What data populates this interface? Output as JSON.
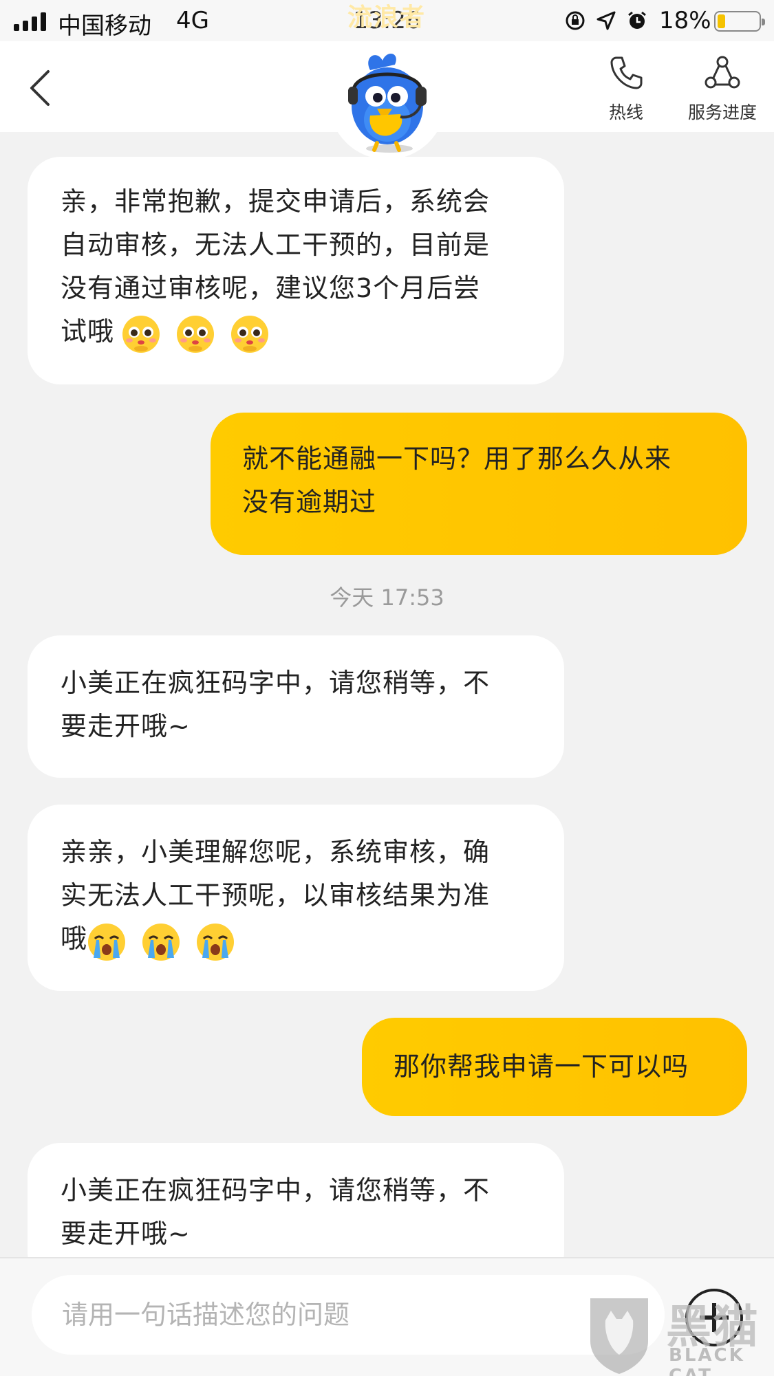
{
  "status_bar": {
    "carrier": "中国移动",
    "network": "4G",
    "time": "13:26",
    "watermark": "流浪者",
    "battery_percent": "18%",
    "battery_level": 0.18,
    "icons": [
      "rotation-lock-icon",
      "location-icon",
      "alarm-icon"
    ]
  },
  "header": {
    "back_icon": "chevron-left-icon",
    "mascot": "bird-mascot-avatar",
    "hotline_label": "热线",
    "hotline_icon": "phone-icon",
    "progress_label": "服务进度",
    "progress_icon": "process-nodes-icon"
  },
  "messages": [
    {
      "from": "bot",
      "text": "亲，非常抱歉，提交申请后，系统会\n自动审核，无法人工干预的，目前是\n没有通过审核呢，建议您3个月后尝\n试哦",
      "emoji": "pleading-face",
      "emoji_count": 3
    },
    {
      "from": "me",
      "text": "就不能通融一下吗？用了那么久从来\n没有逾期过"
    },
    {
      "from": "time",
      "text": "今天 17:53"
    },
    {
      "from": "bot",
      "text": "小美正在疯狂码字中，请您稍等，不\n要走开哦~"
    },
    {
      "from": "bot",
      "text": "亲亲，小美理解您呢，系统审核，确\n实无法人工干预呢，以审核结果为准\n哦",
      "emoji": "crying-face",
      "emoji_count": 3
    },
    {
      "from": "me",
      "text": "那你帮我申请一下可以吗"
    },
    {
      "from": "bot",
      "text": "小美正在疯狂码字中，请您稍等，不\n要走开哦~"
    }
  ],
  "input": {
    "placeholder": "请用一句话描述您的问题",
    "plus_icon": "plus-circle-icon"
  },
  "watermark": {
    "cn": "黑猫",
    "en": "BLACK CAT",
    "logo": "black-cat-shield-logo"
  },
  "colors": {
    "accent": "#ffc600",
    "bot_bubble": "#ffffff",
    "background": "#f2f2f2",
    "timestamp": "#9a9a9a"
  }
}
